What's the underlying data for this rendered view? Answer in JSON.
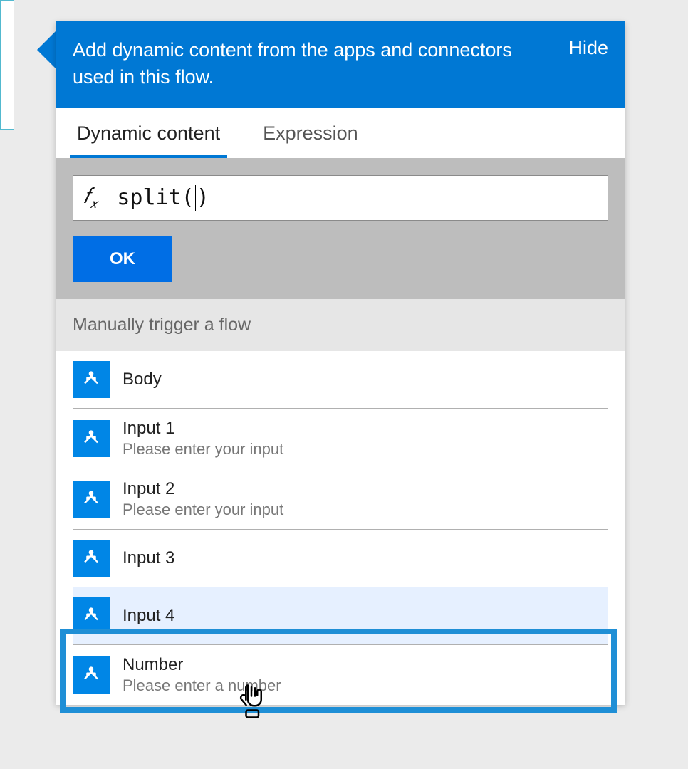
{
  "header": {
    "description": "Add dynamic content from the apps and connectors used in this flow.",
    "hide": "Hide"
  },
  "tabs": {
    "dynamic": "Dynamic content",
    "expression": "Expression"
  },
  "expression": {
    "fx": "fx",
    "value_before_caret": "split(",
    "value_after_caret": ")",
    "ok": "OK"
  },
  "section": {
    "title": "Manually trigger a flow"
  },
  "items": [
    {
      "name": "Body",
      "desc": ""
    },
    {
      "name": "Input 1",
      "desc": "Please enter your input"
    },
    {
      "name": "Input 2",
      "desc": "Please enter your input"
    },
    {
      "name": "Input 3",
      "desc": ""
    },
    {
      "name": "Input 4",
      "desc": ""
    },
    {
      "name": "Number",
      "desc": "Please enter a number"
    }
  ]
}
